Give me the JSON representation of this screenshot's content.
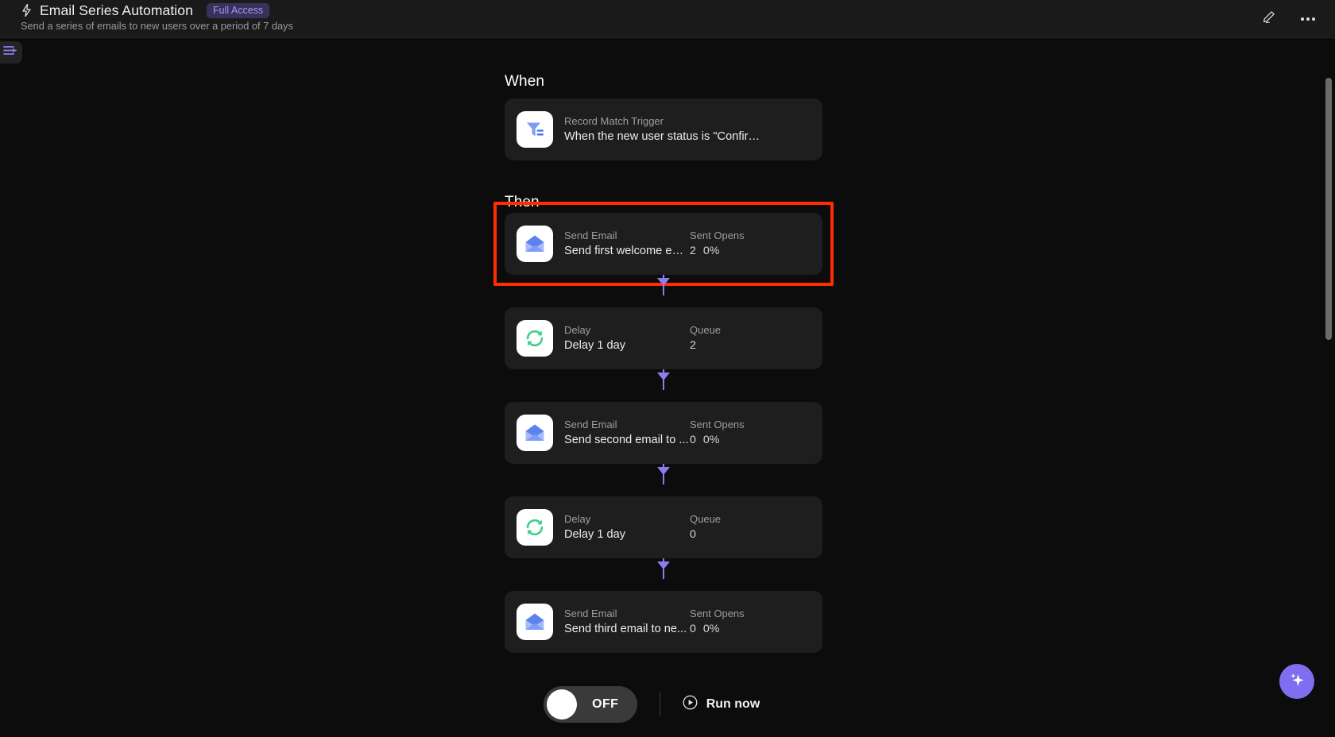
{
  "header": {
    "icon": "bolt-icon",
    "title": "Email Series Automation",
    "badge": "Full Access",
    "subtitle": "Send a series of emails to new users over a period of 7 days",
    "edit_icon": "pencil-icon",
    "more_icon": "more-horizontal-icon"
  },
  "sidebar_toggle": {
    "icon": "panel-expand-icon"
  },
  "flow": {
    "when_label": "When",
    "then_label": "Then",
    "trigger": {
      "icon": "filter-icon",
      "kind": "Record Match Trigger",
      "description": "When the new user status is \"Confirm send e...",
      "stats_head": "",
      "stats_values": []
    },
    "steps": [
      {
        "icon": "email-icon",
        "kind": "Send Email",
        "description": "Send first welcome em...",
        "stats_head": "Sent Opens",
        "stats_values": [
          "2",
          "0%"
        ],
        "highlighted": true
      },
      {
        "icon": "sync-icon",
        "kind": "Delay",
        "description": "Delay 1 day",
        "stats_head": "Queue",
        "stats_values": [
          "2"
        ],
        "highlighted": false
      },
      {
        "icon": "email-icon",
        "kind": "Send Email",
        "description": "Send second email to ...",
        "stats_head": "Sent Opens",
        "stats_values": [
          "0",
          "0%"
        ],
        "highlighted": false
      },
      {
        "icon": "sync-icon",
        "kind": "Delay",
        "description": "Delay 1 day",
        "stats_head": "Queue",
        "stats_values": [
          "0"
        ],
        "highlighted": false
      },
      {
        "icon": "email-icon",
        "kind": "Send Email",
        "description": "Send third email to ne...",
        "stats_head": "Sent Opens",
        "stats_values": [
          "0",
          "0%"
        ],
        "highlighted": false
      }
    ]
  },
  "bottom_bar": {
    "toggle_state": "OFF",
    "run_icon": "play-circle-icon",
    "run_label": "Run now"
  },
  "fab": {
    "icon": "sparkle-icon"
  },
  "colors": {
    "accent_purple": "#7f6ef0",
    "connector": "#8b7ef0",
    "highlight_red": "#ff2d00",
    "badge_text": "#a397f5",
    "badge_bg": "#38325a",
    "icon_blue": "#7e9cf5",
    "icon_green": "#3ecf8e",
    "card_bg": "#1e1e1e",
    "page_bg": "#0c0c0c",
    "header_bg": "#1a1a1a"
  }
}
